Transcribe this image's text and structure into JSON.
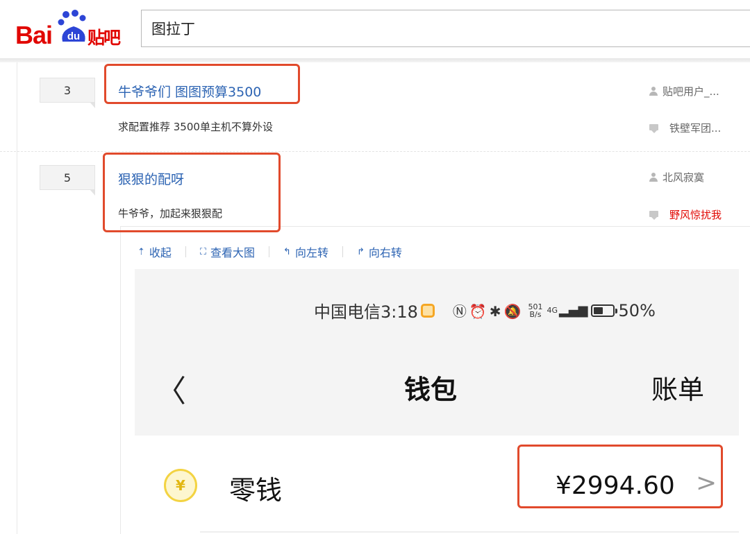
{
  "header": {
    "logo_bai": "Bai",
    "logo_du": "du",
    "logo_tieba": "贴吧",
    "search_value": "图拉丁"
  },
  "threads": [
    {
      "reply_count": "3",
      "title": "牛爷爷们 图图预算3500",
      "desc": "求配置推荐 3500单主机不算外设",
      "author": "贴吧用户_...",
      "last_reply": "铁壁军团..."
    },
    {
      "reply_count": "5",
      "title": "狠狠的配呀",
      "desc": "牛爷爷，加起来狠狠配",
      "author": "北风寂寞",
      "last_reply": "野风惊扰我"
    }
  ],
  "image_toolbar": {
    "collapse": "收起",
    "view_large": "查看大图",
    "rotate_left": "向左转",
    "rotate_right": "向右转"
  },
  "phone": {
    "carrier_time": "中国电信3:18",
    "speed_top": "501",
    "speed_bottom": "B/s",
    "network": "4G",
    "battery": "50%",
    "back": "〈",
    "title": "钱包",
    "right_action": "账单",
    "wallet_label": "零钱",
    "yen_symbol": "¥",
    "balance": "¥2994.60",
    "chevron": ">"
  },
  "colors": {
    "brand_red": "#e10601",
    "link_blue": "#2d64b3",
    "highlight_box": "#e14a2c"
  }
}
